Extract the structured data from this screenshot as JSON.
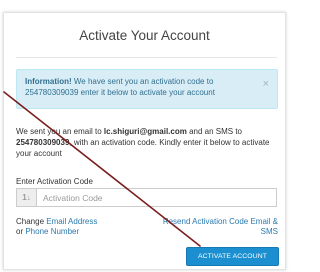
{
  "page": {
    "title": "Activate Your Account"
  },
  "alert": {
    "heading": "Information!",
    "text": " We have sent you an activation code to 254780309039 enter it below to activate your account",
    "close_glyph": "×"
  },
  "message": {
    "part1": "We sent you an email to ",
    "email": "lc.shiguri@gmail.com",
    "part2": " and an SMS to ",
    "phone": "254780309039",
    "part3": ", with an activation code. Kindly enter it below to activate your account"
  },
  "form": {
    "label": "Enter Activation Code",
    "placeholder": "Activation Code",
    "value": "",
    "addon_icon": "sort-numeric-icon",
    "addon_glyph": "1↓"
  },
  "links": {
    "change_prefix": "Change ",
    "change_email": "Email Address",
    "or_text": "or ",
    "change_phone": "Phone Number",
    "resend": "Resend Activation Code Email & SMS"
  },
  "button": {
    "label": "ACTIVATE ACCOUNT"
  },
  "colors": {
    "accent": "#1b8fd0",
    "alert_bg": "#d9edf7",
    "alert_text": "#31708f",
    "link": "#2a7ab0",
    "annotation_line": "#7a1f1f"
  }
}
